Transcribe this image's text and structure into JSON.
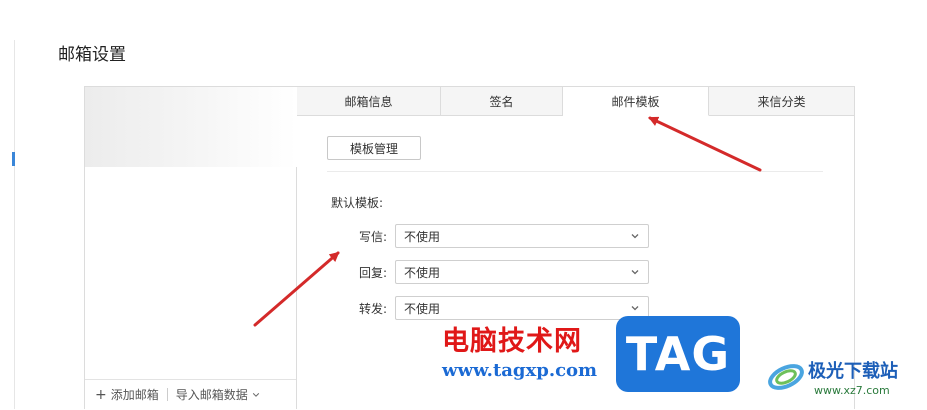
{
  "page": {
    "title": "邮箱设置"
  },
  "tabs": [
    {
      "label": "邮箱信息",
      "active": false
    },
    {
      "label": "签名",
      "active": false
    },
    {
      "label": "邮件模板",
      "active": true
    },
    {
      "label": "来信分类",
      "active": false
    }
  ],
  "sidebar": {
    "add_label": "添加邮箱",
    "import_label": "导入邮箱数据"
  },
  "template": {
    "manage_button": "模板管理",
    "default_label": "默认模板:",
    "rows": [
      {
        "label": "写信:",
        "value": "不使用"
      },
      {
        "label": "回复:",
        "value": "不使用"
      },
      {
        "label": "转发:",
        "value": "不使用"
      }
    ]
  },
  "watermark": {
    "site_cn": "电脑技术网",
    "site_url": "www.tagxp.com",
    "tag_text": "TAG",
    "brand2": "极光下载站",
    "brand2_url": "www.xz7.com"
  },
  "colors": {
    "arrow": "#d42a2a",
    "accent": "#3a86d8",
    "watermark_red": "#e01818",
    "watermark_blue": "#1f76d9"
  }
}
